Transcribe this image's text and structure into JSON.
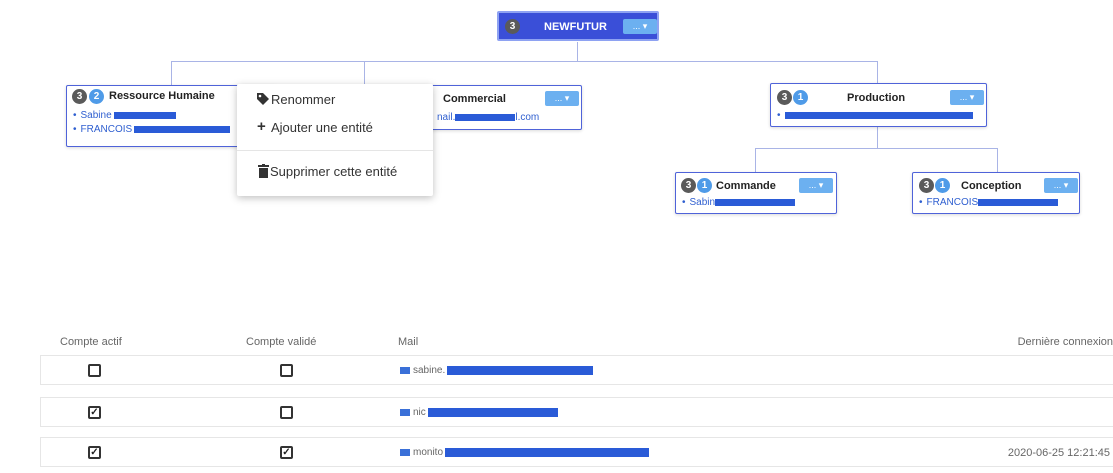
{
  "root": {
    "count": "3",
    "title": "NEWFUTUR",
    "menu": "..."
  },
  "nodes": {
    "rh": {
      "badge1": "3",
      "badge2": "2",
      "title": "Ressource Humaine",
      "members": [
        "Sabine",
        "FRANCOIS"
      ]
    },
    "commercial": {
      "title": "Commercial",
      "member_prefix": "nail.",
      "member_suffix": "l.com",
      "menu": "..."
    },
    "production": {
      "badge1": "3",
      "badge2": "1",
      "title": "Production",
      "menu": "..."
    },
    "commande": {
      "badge1": "3",
      "badge2": "1",
      "title": "Commande",
      "member": "Sabin",
      "menu": "..."
    },
    "conception": {
      "badge1": "3",
      "badge2": "1",
      "title": "Conception",
      "member": "FRANCOIS",
      "menu": "..."
    }
  },
  "context_menu": {
    "rename": "Renommer",
    "add": "Ajouter une entité",
    "delete": "Supprimer cette entité"
  },
  "table": {
    "headers": {
      "active": "Compte actif",
      "validated": "Compte validé",
      "mail": "Mail",
      "last_login": "Dernière connexion"
    },
    "rows": [
      {
        "active": false,
        "validated": false,
        "mail": "sabine.",
        "last_login": ""
      },
      {
        "active": true,
        "validated": false,
        "mail": "nic",
        "last_login": ""
      },
      {
        "active": true,
        "validated": true,
        "mail": "monito",
        "last_login": "2020-06-25 12:21:45"
      }
    ]
  },
  "colors": {
    "accent": "#3a4fd8",
    "node_border": "#4f63d9",
    "badge_blue": "#4f9be8",
    "menu_button": "#6cb0f0"
  },
  "icons": {
    "rename": "tag-icon",
    "add": "plus-icon",
    "delete": "trash-icon",
    "mail": "envelope-icon"
  }
}
